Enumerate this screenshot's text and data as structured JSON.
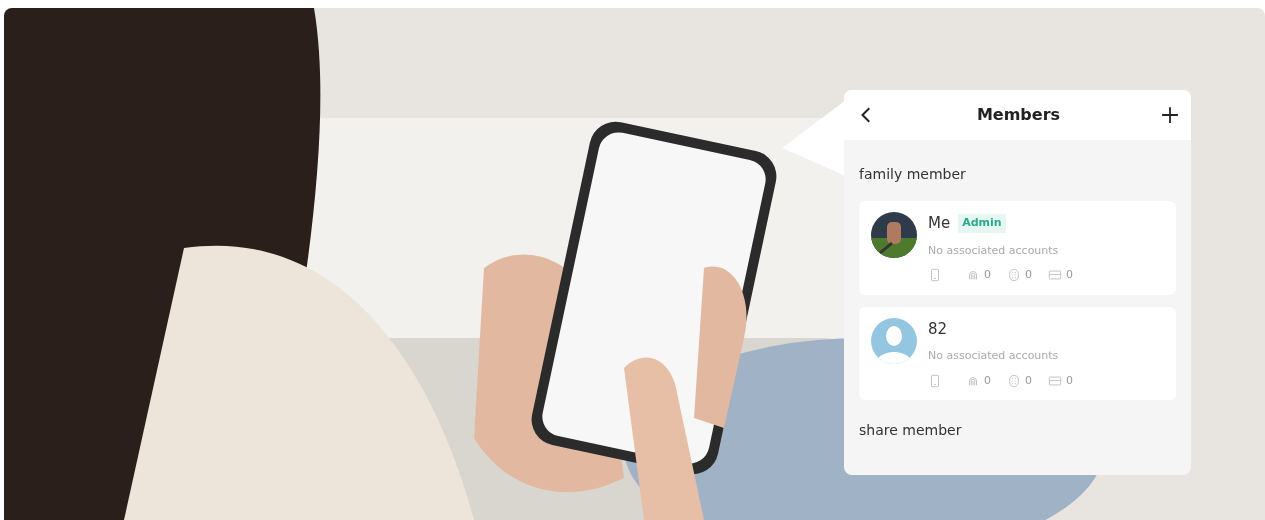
{
  "header": {
    "title": "Members"
  },
  "sections": [
    {
      "label": "family member",
      "members": [
        {
          "name": "Me",
          "badge": "Admin",
          "subtitle": "No associated accounts",
          "counts": [
            "0",
            "0",
            "0"
          ]
        },
        {
          "name": "82",
          "subtitle": "No associated accounts",
          "kind": "default",
          "counts": [
            "0",
            "0",
            "0"
          ]
        }
      ]
    },
    {
      "label": "share member"
    }
  ]
}
